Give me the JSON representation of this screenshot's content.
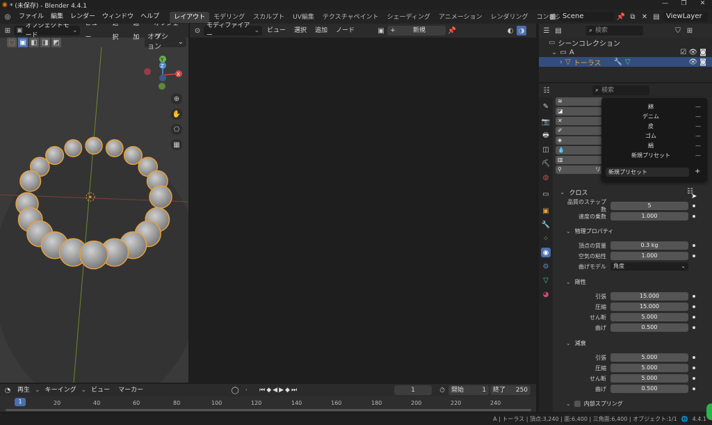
{
  "titlebar": {
    "title": "* (未保存) - Blender 4.4.1",
    "min": "—",
    "max": "❐",
    "close": "✕"
  },
  "menu": [
    "ファイル",
    "編集",
    "レンダー",
    "ウィンドウ",
    "ヘルプ"
  ],
  "workspaces": [
    "レイアウト",
    "モデリング",
    "スカルプト",
    "UV編集",
    "テクスチャペイント",
    "シェーディング",
    "アニメーション",
    "レンダリング",
    "コンポジティング"
  ],
  "scene": {
    "name": "Scene",
    "viewlayer": "ViewLayer"
  },
  "viewport": {
    "mode": "オブジェクトモード",
    "menus": [
      "ビュー",
      "選択",
      "追加",
      "オブジェク"
    ],
    "options": "オプション",
    "gizmo": {
      "x": "X",
      "y": "Y",
      "z": "Z"
    }
  },
  "node_editor": {
    "editor": "モディファイアー",
    "menus": [
      "ビュー",
      "選択",
      "追加",
      "ノード"
    ],
    "new": "新規"
  },
  "outliner": {
    "search": "検索",
    "collection": "シーンコレクション",
    "col_a": "A",
    "object": "トーラス"
  },
  "properties": {
    "search": "検索",
    "presets": [
      "綿",
      "デニム",
      "皮",
      "ゴム",
      "絹",
      "新規プリセット"
    ],
    "preset_input": "新規プリセット",
    "preset_minus": "—",
    "preset_plus": "+",
    "partial_label": "リ",
    "cloth": {
      "title": "クロス",
      "rows": [
        {
          "label": "品質のステップ数",
          "value": "5"
        },
        {
          "label": "速度の乗数",
          "value": "1.000"
        }
      ]
    },
    "physics": {
      "title": "物理プロパティ",
      "rows": [
        {
          "label": "頂点の質量",
          "value": "0.3 kg"
        },
        {
          "label": "空気の粘性",
          "value": "1.000"
        }
      ],
      "bend_label": "曲げモデル",
      "bend_value": "角度"
    },
    "stiffness": {
      "title": "剛性",
      "rows": [
        {
          "label": "引張",
          "value": "15.000"
        },
        {
          "label": "圧縮",
          "value": "15.000"
        },
        {
          "label": "せん断",
          "value": "5.000"
        },
        {
          "label": "曲げ",
          "value": "0.500"
        }
      ]
    },
    "damping": {
      "title": "減衰",
      "rows": [
        {
          "label": "引張",
          "value": "5.000"
        },
        {
          "label": "圧縮",
          "value": "5.000"
        },
        {
          "label": "せん断",
          "value": "5.000"
        },
        {
          "label": "曲げ",
          "value": "0.500"
        }
      ]
    },
    "internal": {
      "title": "内部スプリング"
    }
  },
  "timeline": {
    "menus": [
      "再生",
      "キーイング",
      "ビュー",
      "マーカー"
    ],
    "frame": "1",
    "start_label": "開始",
    "start": "1",
    "end_label": "終了",
    "end": "250",
    "current": "1",
    "ticks": [
      "20",
      "40",
      "60",
      "80",
      "100",
      "120",
      "140",
      "160",
      "180",
      "200",
      "220",
      "240"
    ]
  },
  "statusbar": {
    "text": "A | トーラス | 頂点:3,240 | 面:6,400 | 三角面:6,400 | オブジェクト:1/1",
    "version": "4.4.1"
  }
}
